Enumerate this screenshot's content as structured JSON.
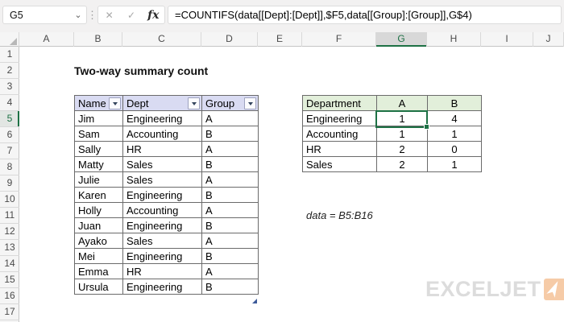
{
  "chrome": {
    "name_box_value": "G5",
    "name_box_chevron": "⌄",
    "cancel_label": "✕",
    "enter_label": "✓",
    "fx_label": "fx",
    "dots": "⋮",
    "formula": "=COUNTIFS(data[[Dept]:[Dept]],$F5,data[[Group]:[Group]],G$4)"
  },
  "grid": {
    "column_letters": [
      "A",
      "B",
      "C",
      "D",
      "E",
      "F",
      "G",
      "H",
      "I",
      "J"
    ],
    "selected_column": "G",
    "row_numbers": [
      "1",
      "2",
      "3",
      "4",
      "5",
      "6",
      "7",
      "8",
      "9",
      "10",
      "11",
      "12",
      "13",
      "14",
      "15",
      "16",
      "17"
    ],
    "selected_row": "5"
  },
  "sheet": {
    "title": "Two-way summary count",
    "note": "data = B5:B16"
  },
  "data_table": {
    "headers": [
      "Name",
      "Dept",
      "Group"
    ],
    "rows": [
      [
        "Jim",
        "Engineering",
        "A"
      ],
      [
        "Sam",
        "Accounting",
        "B"
      ],
      [
        "Sally",
        "HR",
        "A"
      ],
      [
        "Matty",
        "Sales",
        "B"
      ],
      [
        "Julie",
        "Sales",
        "A"
      ],
      [
        "Karen",
        "Engineering",
        "B"
      ],
      [
        "Holly",
        "Accounting",
        "A"
      ],
      [
        "Juan",
        "Engineering",
        "B"
      ],
      [
        "Ayako",
        "Sales",
        "A"
      ],
      [
        "Mei",
        "Engineering",
        "B"
      ],
      [
        "Emma",
        "HR",
        "A"
      ],
      [
        "Ursula",
        "Engineering",
        "B"
      ]
    ]
  },
  "summary_table": {
    "headers": [
      "Department",
      "A",
      "B"
    ],
    "rows": [
      [
        "Engineering",
        "1",
        "4"
      ],
      [
        "Accounting",
        "1",
        "1"
      ],
      [
        "HR",
        "2",
        "0"
      ],
      [
        "Sales",
        "2",
        "1"
      ]
    ],
    "selected_cell": "G5",
    "selected_value": "1"
  },
  "logo": {
    "text": "EXCELJET"
  },
  "colors": {
    "excel_green": "#1E7145",
    "table_header_blue": "#D9DBF2",
    "summary_header_green": "#E2EFDA",
    "logo_orange": "#F6CBA7",
    "logo_gray": "#DCDCDC",
    "resize_handle_blue": "#3C5A99"
  }
}
